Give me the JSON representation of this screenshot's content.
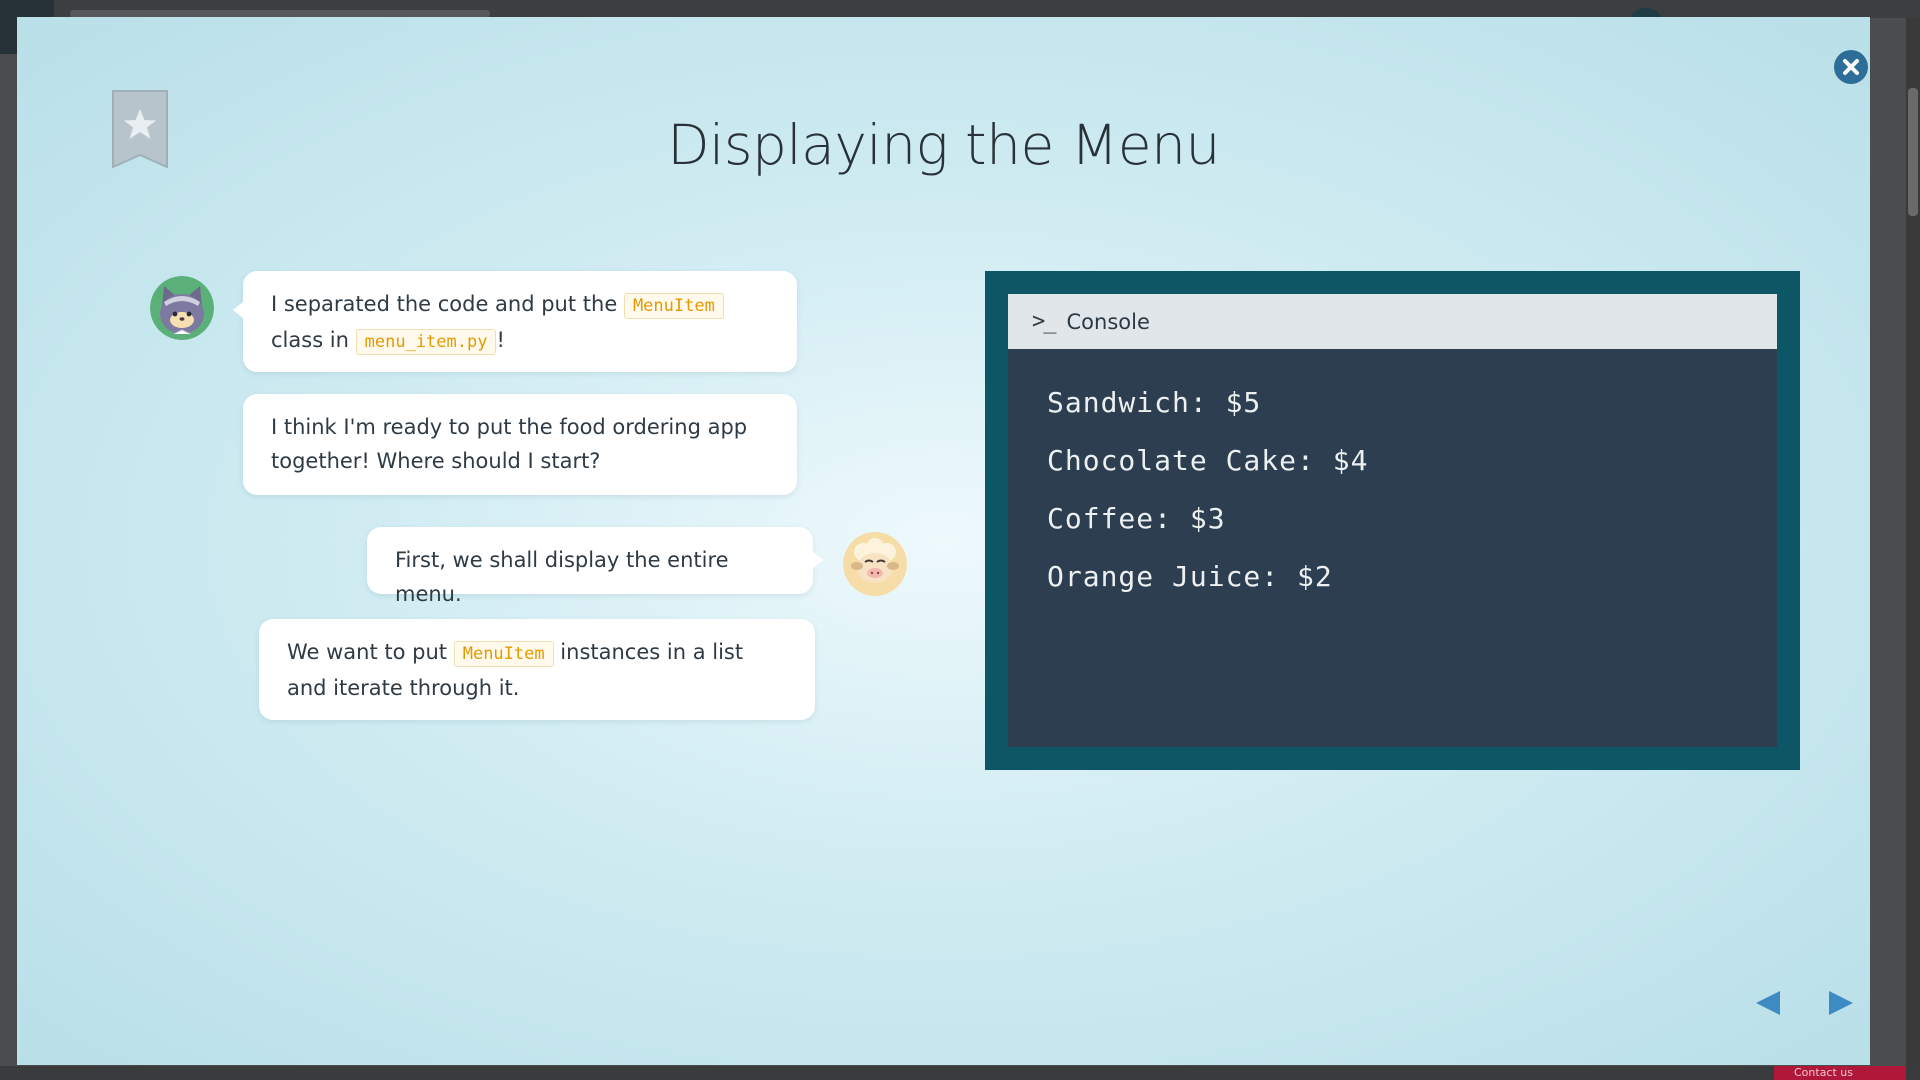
{
  "lesson": {
    "title": "Displaying the Menu"
  },
  "chat": {
    "messages": [
      {
        "speaker": "cat",
        "parts": [
          "I separated the code and put the",
          "MenuItem",
          "class in",
          "menu_item.py",
          "!"
        ]
      },
      {
        "speaker": "cat",
        "text": "I think I'm ready to put the food ordering app together! Where should I start?"
      },
      {
        "speaker": "sheep",
        "text": "First, we shall display the entire menu."
      },
      {
        "speaker": "sheep",
        "parts": [
          "We want to put",
          "MenuItem",
          "instances in a list and iterate through it."
        ]
      }
    ]
  },
  "console": {
    "title": "Console",
    "icon": "terminal-prompt-icon",
    "output": [
      "Sandwich: $5",
      "Chocolate Cake: $4",
      "Coffee: $3",
      "Orange Juice: $2"
    ]
  },
  "background": {
    "contact_label": "Contact us"
  },
  "colors": {
    "console_frame": "#0c5666",
    "console_body": "#2c3e50",
    "code_text": "#e49a00",
    "close_button": "#2c6e97",
    "nav_arrow": "#3d8bc2"
  }
}
